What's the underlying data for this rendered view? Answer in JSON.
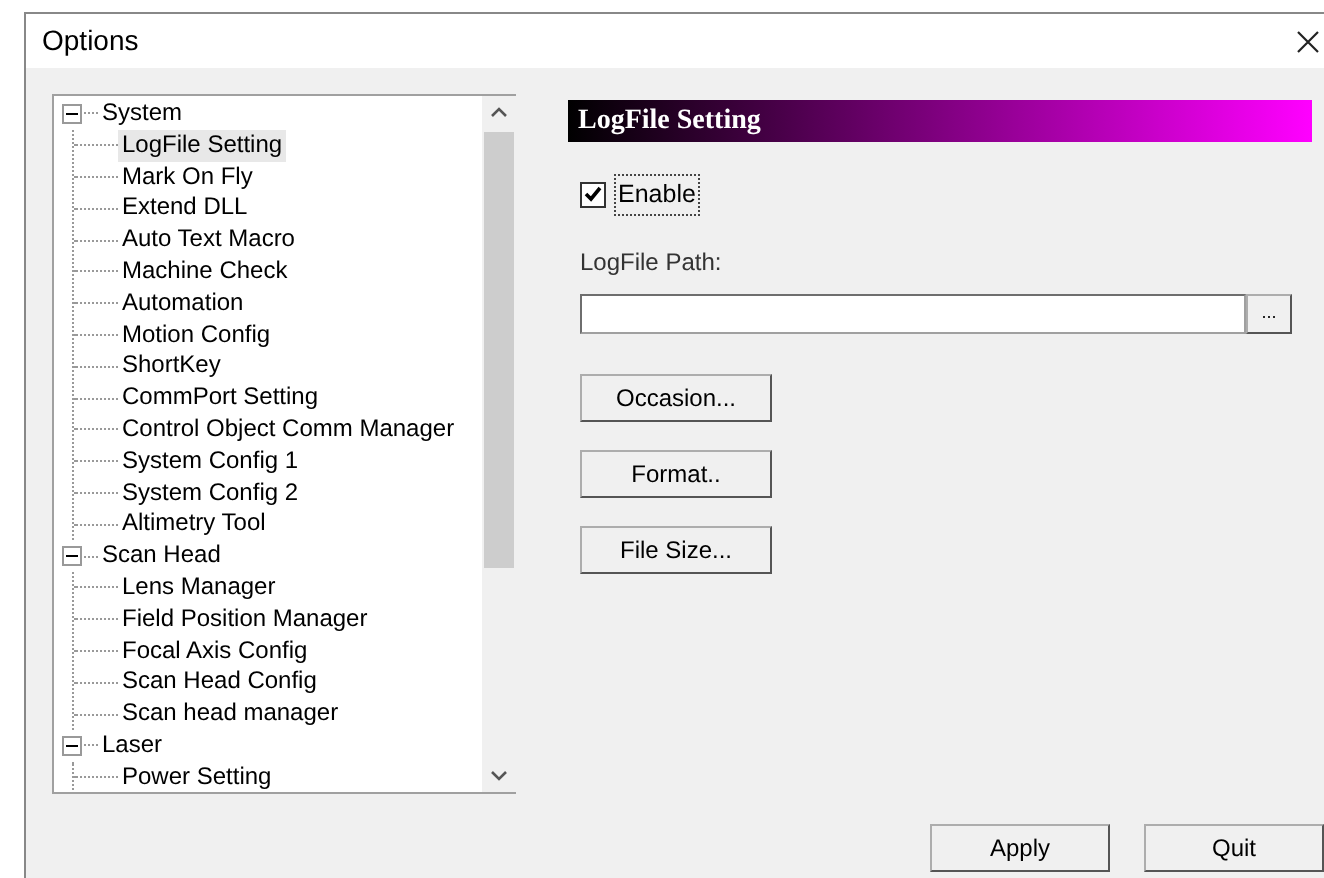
{
  "window": {
    "title": "Options"
  },
  "tree": [
    {
      "label": "System",
      "expanded": true,
      "selected": false,
      "children": [
        {
          "label": "LogFile Setting",
          "selected": true
        },
        {
          "label": "Mark On Fly",
          "selected": false
        },
        {
          "label": "Extend DLL",
          "selected": false
        },
        {
          "label": "Auto Text Macro",
          "selected": false
        },
        {
          "label": "Machine Check",
          "selected": false
        },
        {
          "label": "Automation",
          "selected": false
        },
        {
          "label": "Motion Config",
          "selected": false
        },
        {
          "label": "ShortKey",
          "selected": false
        },
        {
          "label": "CommPort Setting",
          "selected": false
        },
        {
          "label": "Control Object Comm Manager",
          "selected": false
        },
        {
          "label": "System Config 1",
          "selected": false
        },
        {
          "label": "System Config 2",
          "selected": false
        },
        {
          "label": "Altimetry Tool",
          "selected": false
        }
      ]
    },
    {
      "label": "Scan Head",
      "expanded": true,
      "selected": false,
      "children": [
        {
          "label": "Lens Manager",
          "selected": false
        },
        {
          "label": "Field Position Manager",
          "selected": false
        },
        {
          "label": "Focal Axis Config",
          "selected": false
        },
        {
          "label": "Scan Head Config",
          "selected": false
        },
        {
          "label": "Scan head manager",
          "selected": false
        }
      ]
    },
    {
      "label": "Laser",
      "expanded": true,
      "selected": false,
      "children": [
        {
          "label": "Power Setting",
          "selected": false
        }
      ]
    }
  ],
  "panel": {
    "title": "LogFile Setting",
    "enable": {
      "label": "Enable",
      "checked": true
    },
    "path": {
      "label": "LogFile Path:",
      "browse": "..."
    },
    "buttons": [
      "Occasion...",
      "Format..",
      "File Size..."
    ]
  },
  "footer_buttons": [
    "Apply",
    "Quit"
  ]
}
